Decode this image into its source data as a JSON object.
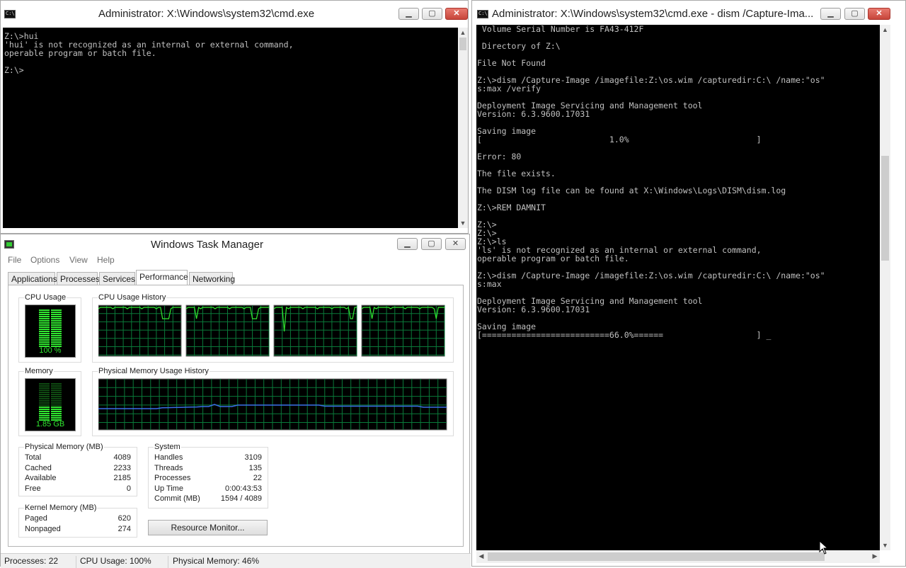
{
  "cmd1": {
    "title": "Administrator: X:\\Windows\\system32\\cmd.exe",
    "lines": [
      "Z:\\>hui",
      "'hui' is not recognized as an internal or external command,",
      "operable program or batch file.",
      "",
      "Z:\\>"
    ]
  },
  "cmd2": {
    "title": "Administrator: X:\\Windows\\system32\\cmd.exe - dism  /Capture-Ima...",
    "lines": [
      " Volume Serial Number is FA43-412F",
      "",
      " Directory of Z:\\",
      "",
      "File Not Found",
      "",
      "Z:\\>dism /Capture-Image /imagefile:Z:\\os.wim /capturedir:C:\\ /name:\"os\"",
      "s:max /verify",
      "",
      "Deployment Image Servicing and Management tool",
      "Version: 6.3.9600.17031",
      "",
      "Saving image",
      "[                          1.0%                          ]",
      "",
      "Error: 80",
      "",
      "The file exists.",
      "",
      "The DISM log file can be found at X:\\Windows\\Logs\\DISM\\dism.log",
      "",
      "Z:\\>REM DAMNIT",
      "",
      "Z:\\>",
      "Z:\\>",
      "Z:\\>ls",
      "'ls' is not recognized as an internal or external command,",
      "operable program or batch file.",
      "",
      "Z:\\>dism /Capture-Image /imagefile:Z:\\os.wim /capturedir:C:\\ /name:\"os\"",
      "s:max",
      "",
      "Deployment Image Servicing and Management tool",
      "Version: 6.3.9600.17031",
      "",
      "Saving image",
      "[==========================66.0%======                   ] _"
    ]
  },
  "taskmgr": {
    "title": "Windows Task Manager",
    "menu": [
      "File",
      "Options",
      "View",
      "Help"
    ],
    "tabs": [
      "Applications",
      "Processes",
      "Services",
      "Performance",
      "Networking"
    ],
    "active_tab": "Performance",
    "cpu_usage_label": "CPU Usage",
    "cpu_usage_value": "100 %",
    "cpu_fraction": 1.0,
    "cpu_history_label": "CPU Usage History",
    "memory_label": "Memory",
    "memory_value": "1.85 GB",
    "memory_fraction": 0.46,
    "phys_history_label": "Physical Memory Usage History",
    "physical_memory": {
      "label": "Physical Memory (MB)",
      "rows": [
        [
          "Total",
          "4089"
        ],
        [
          "Cached",
          "2233"
        ],
        [
          "Available",
          "2185"
        ],
        [
          "Free",
          "0"
        ]
      ]
    },
    "kernel_memory": {
      "label": "Kernel Memory (MB)",
      "rows": [
        [
          "Paged",
          "620"
        ],
        [
          "Nonpaged",
          "274"
        ]
      ]
    },
    "system": {
      "label": "System",
      "rows": [
        [
          "Handles",
          "3109"
        ],
        [
          "Threads",
          "135"
        ],
        [
          "Processes",
          "22"
        ],
        [
          "Up Time",
          "0:00:43:53"
        ],
        [
          "Commit (MB)",
          "1594 / 4089"
        ]
      ]
    },
    "resource_monitor_button": "Resource Monitor...",
    "status": {
      "processes": "Processes: 22",
      "cpu": "CPU Usage: 100%",
      "memory": "Physical Memory: 46%"
    }
  },
  "colors": {
    "graph_green": "#30e830",
    "grid_green": "#0a7a3a",
    "memory_line": "#3a6ee8",
    "console_text": "#c0c0c0"
  }
}
